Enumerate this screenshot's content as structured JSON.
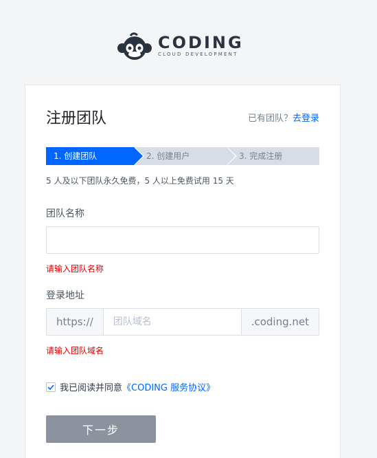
{
  "logo": {
    "title": "CODING",
    "subtitle": "CLOUD DEVELOPMENT",
    "icon": "monkey-logo-icon"
  },
  "card": {
    "title": "注册团队",
    "login_hint": "已有团队？",
    "login_link": "去登录"
  },
  "steps": [
    {
      "label": "1. 创建团队",
      "active": true
    },
    {
      "label": "2. 创建用户",
      "active": false
    },
    {
      "label": "3. 完成注册",
      "active": false
    }
  ],
  "note": "5 人及以下团队永久免费，5 人以上免费试用 15 天",
  "team_name": {
    "label": "团队名称",
    "value": "",
    "placeholder": "",
    "error": "请输入团队名称"
  },
  "login_address": {
    "label": "登录地址",
    "prefix": "https://",
    "placeholder": "团队域名",
    "suffix": ".coding.net",
    "error": "请输入团队域名"
  },
  "agreement": {
    "checked": true,
    "text": "我已阅读并同意",
    "link": "《CODING 服务协议》"
  },
  "next_button": "下一步",
  "colors": {
    "primary": "#0066ff",
    "error": "#e00000",
    "button_disabled": "#8c939e"
  }
}
